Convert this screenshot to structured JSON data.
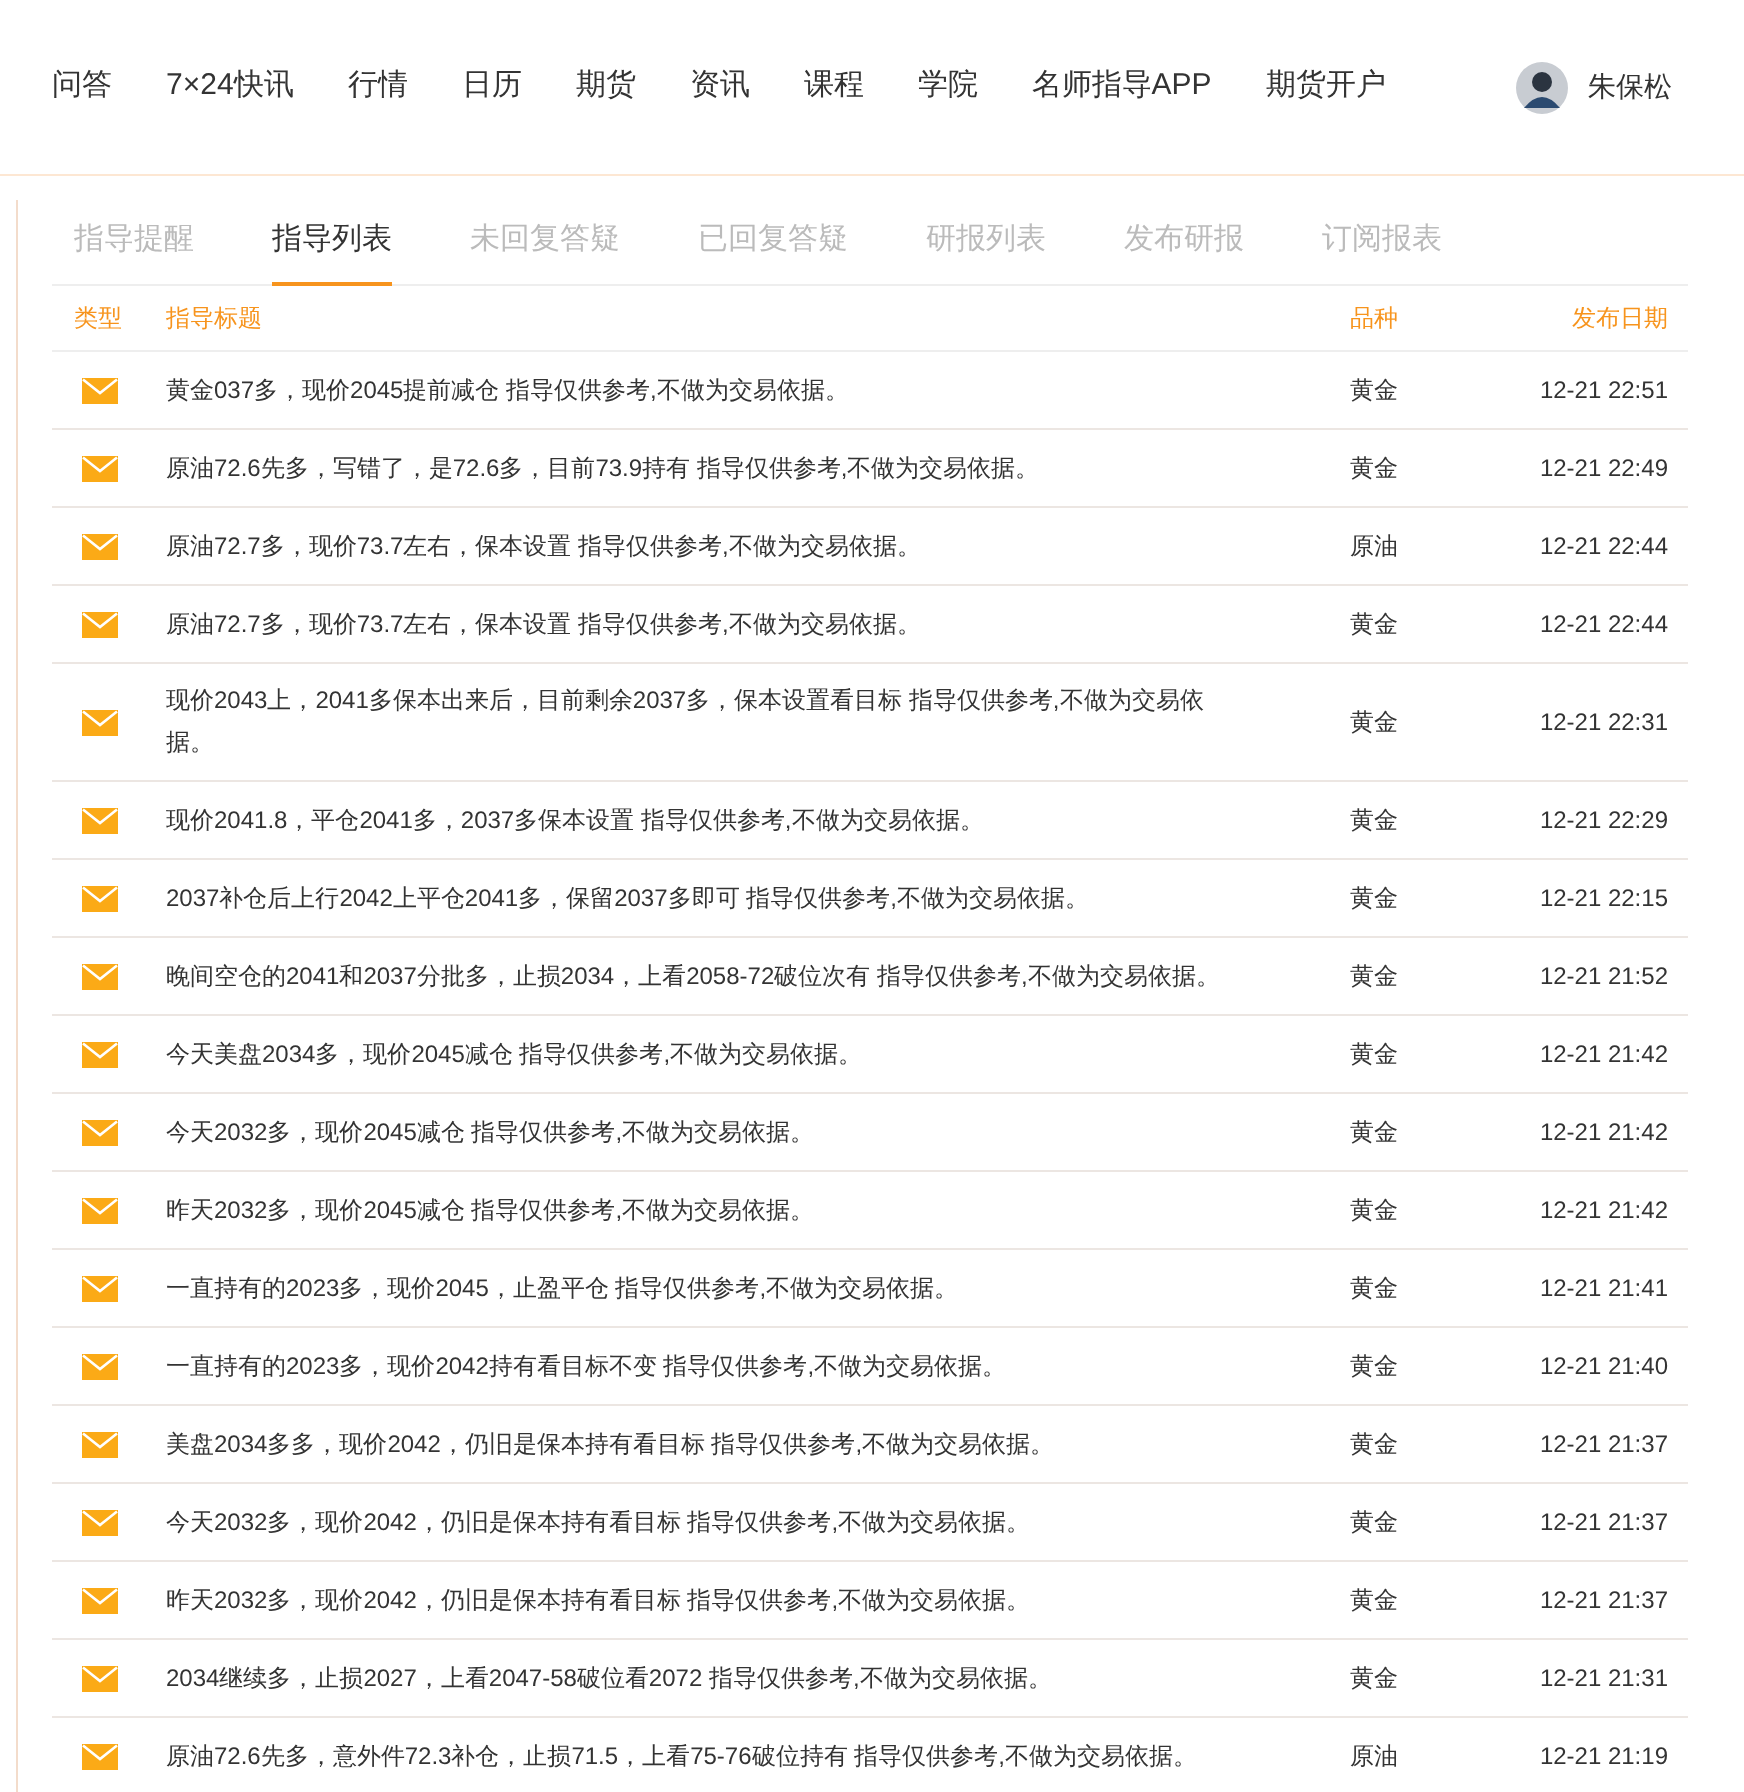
{
  "nav": {
    "items": [
      "问答",
      "7×24快讯",
      "行情",
      "日历",
      "期货",
      "资讯",
      "课程",
      "学院",
      "名师指导APP",
      "期货开户"
    ],
    "user": {
      "name": "朱保松"
    }
  },
  "tabs": [
    {
      "label": "指导提醒",
      "selected": false
    },
    {
      "label": "指导列表",
      "selected": true
    },
    {
      "label": "未回复答疑",
      "selected": false
    },
    {
      "label": "已回复答疑",
      "selected": false
    },
    {
      "label": "研报列表",
      "selected": false
    },
    {
      "label": "发布研报",
      "selected": false
    },
    {
      "label": "订阅报表",
      "selected": false
    }
  ],
  "table": {
    "columns": [
      "类型",
      "指导标题",
      "品种",
      "发布日期"
    ],
    "rows": [
      {
        "title": "黄金037多，现价2045提前减仓 指导仅供参考,不做为交易依据。",
        "variety": "黄金",
        "date": "12-21 22:51"
      },
      {
        "title": "原油72.6先多，写错了，是72.6多，目前73.9持有 指导仅供参考,不做为交易依据。",
        "variety": "黄金",
        "date": "12-21 22:49"
      },
      {
        "title": "原油72.7多，现价73.7左右，保本设置 指导仅供参考,不做为交易依据。",
        "variety": "原油",
        "date": "12-21 22:44"
      },
      {
        "title": "原油72.7多，现价73.7左右，保本设置 指导仅供参考,不做为交易依据。",
        "variety": "黄金",
        "date": "12-21 22:44"
      },
      {
        "title": "现价2043上，2041多保本出来后，目前剩余2037多，保本设置看目标 指导仅供参考,不做为交易依据。",
        "variety": "黄金",
        "date": "12-21 22:31"
      },
      {
        "title": "现价2041.8，平仓2041多，2037多保本设置 指导仅供参考,不做为交易依据。",
        "variety": "黄金",
        "date": "12-21 22:29"
      },
      {
        "title": "2037补仓后上行2042上平仓2041多，保留2037多即可 指导仅供参考,不做为交易依据。",
        "variety": "黄金",
        "date": "12-21 22:15"
      },
      {
        "title": "晚间空仓的2041和2037分批多，止损2034，上看2058-72破位次有 指导仅供参考,不做为交易依据。",
        "variety": "黄金",
        "date": "12-21 21:52"
      },
      {
        "title": "今天美盘2034多，现价2045减仓 指导仅供参考,不做为交易依据。",
        "variety": "黄金",
        "date": "12-21 21:42"
      },
      {
        "title": "今天2032多，现价2045减仓 指导仅供参考,不做为交易依据。",
        "variety": "黄金",
        "date": "12-21 21:42"
      },
      {
        "title": "昨天2032多，现价2045减仓 指导仅供参考,不做为交易依据。",
        "variety": "黄金",
        "date": "12-21 21:42"
      },
      {
        "title": "一直持有的2023多，现价2045，止盈平仓 指导仅供参考,不做为交易依据。",
        "variety": "黄金",
        "date": "12-21 21:41"
      },
      {
        "title": "一直持有的2023多，现价2042持有看目标不变 指导仅供参考,不做为交易依据。",
        "variety": "黄金",
        "date": "12-21 21:40"
      },
      {
        "title": "美盘2034多多，现价2042，仍旧是保本持有看目标 指导仅供参考,不做为交易依据。",
        "variety": "黄金",
        "date": "12-21 21:37"
      },
      {
        "title": "今天2032多，现价2042，仍旧是保本持有看目标 指导仅供参考,不做为交易依据。",
        "variety": "黄金",
        "date": "12-21 21:37"
      },
      {
        "title": "昨天2032多，现价2042，仍旧是保本持有看目标 指导仅供参考,不做为交易依据。",
        "variety": "黄金",
        "date": "12-21 21:37"
      },
      {
        "title": "2034继续多，止损2027，上看2047-58破位看2072 指导仅供参考,不做为交易依据。",
        "variety": "黄金",
        "date": "12-21 21:31"
      },
      {
        "title": "原油72.6先多，意外件72.3补仓，止损71.5，上看75-76破位持有 指导仅供参考,不做为交易依据。",
        "variety": "原油",
        "date": "12-21 21:19"
      }
    ]
  }
}
